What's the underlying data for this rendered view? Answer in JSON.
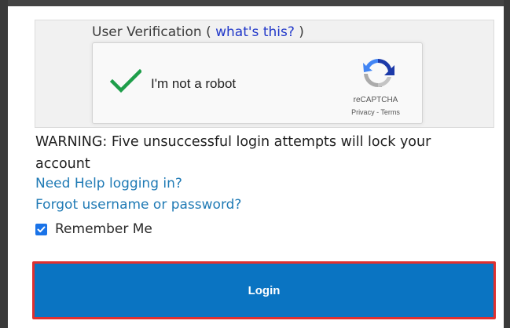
{
  "verification": {
    "title_prefix": "User Verification (",
    "whats_this": "what's this?",
    "title_suffix": ")"
  },
  "recaptcha": {
    "checkbox_label": "I'm not a robot",
    "brand": "reCAPTCHA",
    "privacy": "Privacy",
    "separator": " - ",
    "terms": "Terms",
    "checked": true
  },
  "warning": "WARNING: Five unsuccessful login attempts will lock your account",
  "links": {
    "help": "Need Help logging in?",
    "forgot": "Forgot username or password?"
  },
  "remember": {
    "label": "Remember Me",
    "checked": true
  },
  "login": {
    "label": "Login"
  },
  "colors": {
    "link": "#1f7ab5",
    "whats_this_link": "#2138c9",
    "login_button": "#0a74c2",
    "login_outline": "#e0302f",
    "checkmark": "#1e9e4a",
    "checkbox": "#1a73e8"
  }
}
